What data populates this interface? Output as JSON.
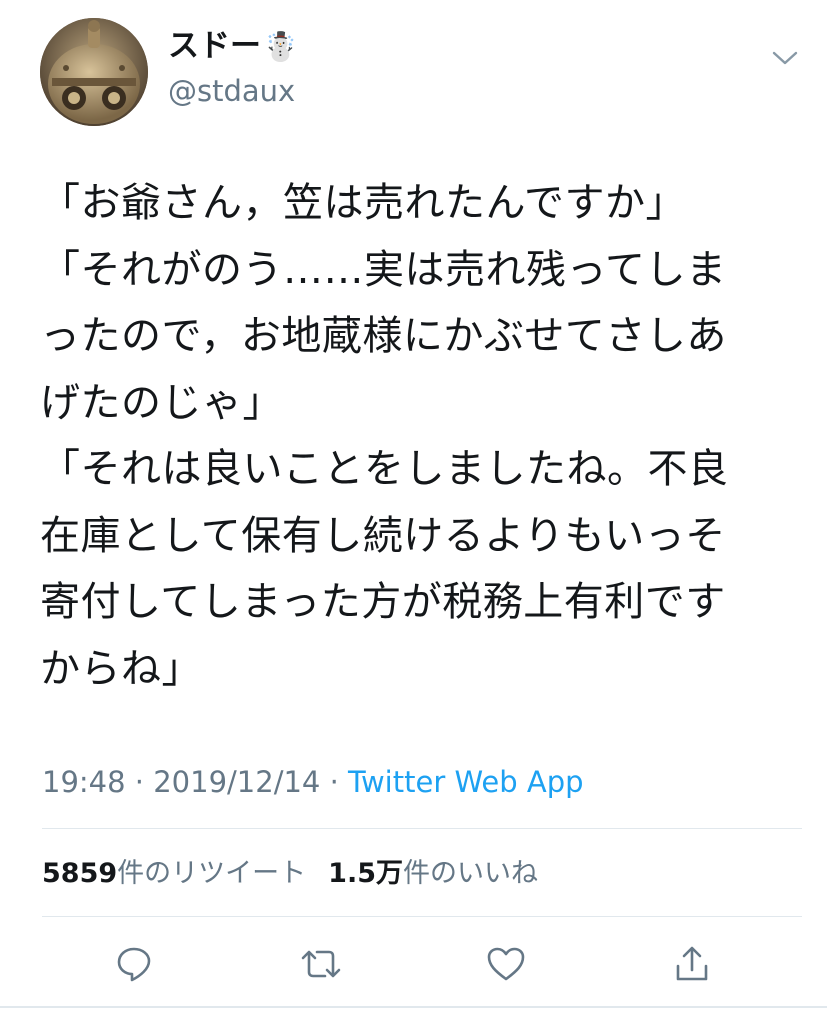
{
  "user": {
    "display_name": "スドー",
    "name_emoji": "☃️",
    "handle": "@stdaux",
    "avatar_icon": "robot-head-avatar"
  },
  "tweet": {
    "lines": [
      "「お爺さん，笠は売れたんですか」",
      "「それがのう……実は売れ残ってしま",
      "ったので，お地蔵様にかぶせてさしあ",
      "げたのじゃ」",
      "「それは良いことをしましたね。不良",
      "在庫として保有し続けるよりもいっそ",
      "寄付してしまった方が税務上有利です",
      "からね」"
    ]
  },
  "meta": {
    "time": "19:48",
    "separator": " · ",
    "date": "2019/12/14",
    "source": "Twitter Web App"
  },
  "stats": {
    "retweet_count": "5859",
    "retweet_label": "件のリツイート",
    "like_count": "1.5万",
    "like_label": "件のいいね"
  },
  "actions": {
    "reply_icon": "reply-icon",
    "retweet_icon": "retweet-icon",
    "like_icon": "heart-icon",
    "share_icon": "share-icon"
  },
  "colors": {
    "text": "#14171a",
    "secondary": "#657786",
    "link": "#1da1f2",
    "divider": "#e1e8ed",
    "icon": "#657786"
  }
}
